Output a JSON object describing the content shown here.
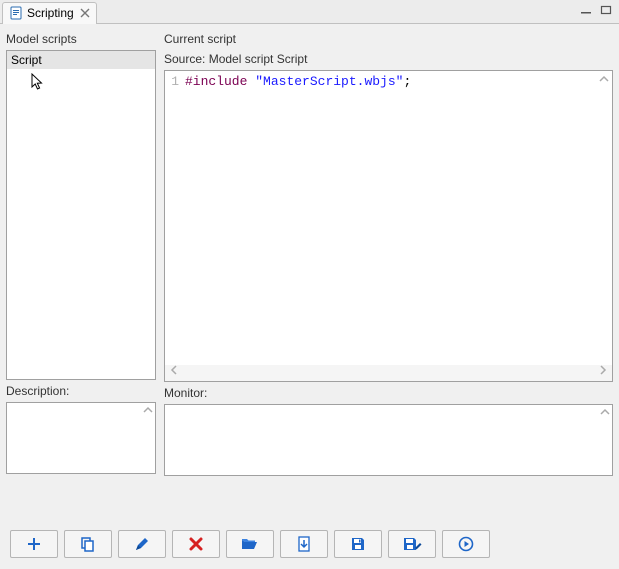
{
  "tab": {
    "title": "Scripting"
  },
  "left": {
    "group_label": "Model scripts",
    "items": [
      "Script"
    ],
    "selected_index": 0,
    "description_label": "Description:"
  },
  "right": {
    "group_label": "Current script",
    "source_label_prefix": "Source: ",
    "source_name": "Model script Script",
    "editor": {
      "lines": [
        {
          "n": 1,
          "text": "#include \"MasterScript.wbjs\";"
        }
      ]
    },
    "monitor_label": "Monitor:"
  },
  "toolbar": {
    "add": "Add",
    "copy": "Copy",
    "edit": "Edit",
    "remove": "Remove",
    "open": "Open",
    "reload": "Reload",
    "save": "Save",
    "saveAs": "Save As",
    "run": "Run"
  }
}
